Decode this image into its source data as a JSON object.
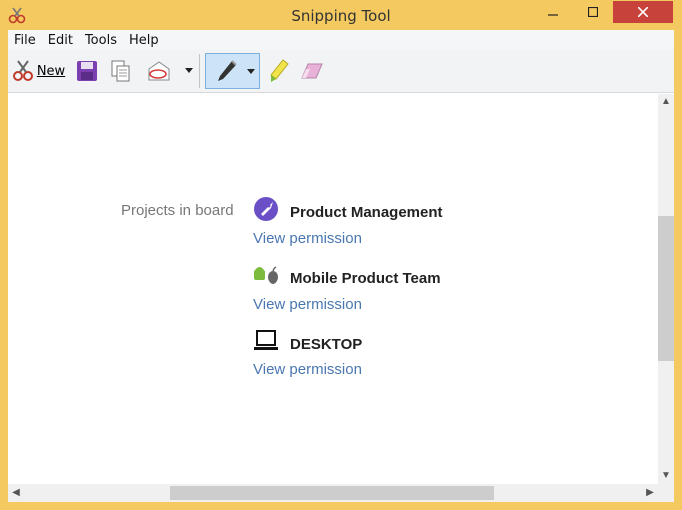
{
  "window": {
    "title": "Snipping Tool"
  },
  "menu": [
    "File",
    "Edit",
    "Tools",
    "Help"
  ],
  "toolbar": {
    "new_label": "New"
  },
  "board": {
    "label": "Projects in board",
    "projects": [
      {
        "name": "Product Management",
        "action": "View permission"
      },
      {
        "name": "Mobile Product Team",
        "action": "View permission"
      },
      {
        "name": "DESKTOP",
        "action": "View permission"
      }
    ]
  },
  "colors": {
    "frame": "#f4c960",
    "link": "#4a77b0",
    "close": "#c7423a"
  }
}
